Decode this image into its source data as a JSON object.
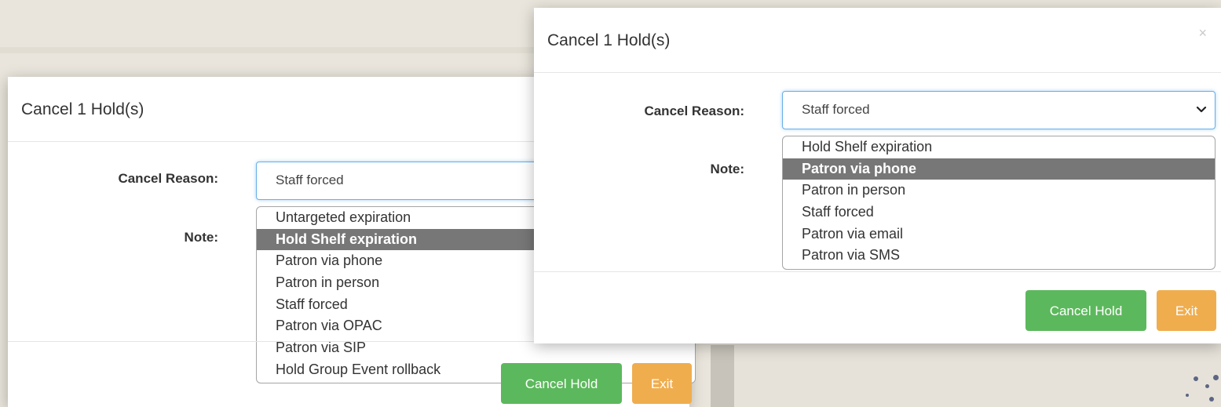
{
  "back_dialog": {
    "title": "Cancel 1 Hold(s)",
    "cancel_reason_label": "Cancel Reason:",
    "note_label": "Note:",
    "selected_value": "Staff forced",
    "options": [
      {
        "label": "Untargeted expiration",
        "highlighted": false
      },
      {
        "label": "Hold Shelf expiration",
        "highlighted": true
      },
      {
        "label": "Patron via phone",
        "highlighted": false
      },
      {
        "label": "Patron in person",
        "highlighted": false
      },
      {
        "label": "Staff forced",
        "highlighted": false
      },
      {
        "label": "Patron via OPAC",
        "highlighted": false
      },
      {
        "label": "Patron via SIP",
        "highlighted": false
      },
      {
        "label": "Hold Group Event rollback",
        "highlighted": false
      }
    ],
    "cancel_button_label": "Cancel Hold",
    "exit_button_label": "Exit"
  },
  "front_dialog": {
    "title": "Cancel 1 Hold(s)",
    "close_glyph": "×",
    "cancel_reason_label": "Cancel Reason:",
    "note_label": "Note:",
    "selected_value": "Staff forced",
    "options": [
      {
        "label": "Hold Shelf expiration",
        "highlighted": false
      },
      {
        "label": "Patron via phone",
        "highlighted": true
      },
      {
        "label": "Patron in person",
        "highlighted": false
      },
      {
        "label": "Staff forced",
        "highlighted": false
      },
      {
        "label": "Patron via email",
        "highlighted": false
      },
      {
        "label": "Patron via SMS",
        "highlighted": false
      }
    ],
    "cancel_button_label": "Cancel Hold",
    "exit_button_label": "Exit"
  },
  "colors": {
    "accent_border": "#66afe9",
    "highlight": "#777777",
    "cancel_button": "#5cb85c",
    "exit_button": "#f0ad4e"
  },
  "icons": {
    "select_caret": "chevron-down-icon",
    "close": "close-icon"
  }
}
